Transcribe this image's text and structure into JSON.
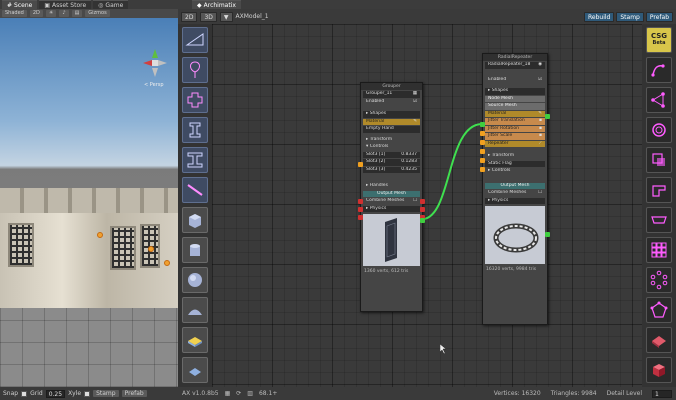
{
  "scene_tabs": [
    {
      "label": "Scene",
      "icon": "scene-icon"
    },
    {
      "label": "Asset Store",
      "icon": "store-icon"
    },
    {
      "label": "Game",
      "icon": "game-icon"
    }
  ],
  "ax_tab": {
    "label": "Archimatix"
  },
  "scene_toolbar": {
    "shading": "Shaded",
    "mode_2d": "2D",
    "gizmos": "Gizmos"
  },
  "scene_view": {
    "persp_label": "< Persp"
  },
  "scene_bottom": {
    "snap_label": "Snap",
    "grid_label": "Grid",
    "grid_value": "0.25",
    "xyle_label": "Xyle",
    "stamp": "Stamp",
    "prefab": "Prefab"
  },
  "ax_header": {
    "btn_2d": "2D",
    "btn_3d": "3D",
    "model_name": "AXModel_1",
    "rebuild": "Rebuild",
    "stamp": "Stamp",
    "prefab": "Prefab"
  },
  "library_icons": [
    "plane-shape-icon",
    "lamp-shape-icon",
    "cross-shape-icon",
    "ibeam-shape-icon",
    "ibeam-wide-icon",
    "bar-shape-icon",
    "box-mesh-icon",
    "cylinder-mesh-icon",
    "sphere-mesh-icon",
    "curved-plane-icon",
    "platform-mesh-icon",
    "library-more-icon"
  ],
  "grouper_node": {
    "title": "Grouper",
    "name": "Grouper_11",
    "enabled": "Enabled",
    "shapes": "Shapes",
    "material": "Material",
    "empty_hand": "Empty Hand",
    "transform": "Transform",
    "controls": "Controls",
    "params": [
      {
        "label": "Slot3 [1]",
        "value": "0.8337"
      },
      {
        "label": "Slot3 [2]",
        "value": "0.1283"
      },
      {
        "label": "Slot3 [3]",
        "value": "0.4235"
      }
    ],
    "handles": "Handles",
    "output_mesh": "Output Mesh",
    "combine_meshes": "Combine Meshes",
    "physics": "Physics",
    "stats": "1360 verts, 612 tris"
  },
  "radial_node": {
    "title": "RadialRepeater",
    "name": "RadialRepeater_18",
    "enabled": "Enabled",
    "shapes": "Shapes",
    "node_mesh": "Node Mesh",
    "source_mesh": "Source Mesh",
    "material": "Material",
    "jitter_translation": "Jitter Translation",
    "jitter_rotation": "Jitter Rotation",
    "jitter_scale": "Jitter Scale",
    "repeater": "Repeater",
    "transform": "Transform",
    "static_flag": "Static Flag",
    "controls": "Controls",
    "output_mesh": "Output Mesh",
    "combine_meshes": "Combine Meshes",
    "physics": "Physics",
    "stats": "16320 verts, 9984 tris"
  },
  "tools": {
    "csg_title": "CSG",
    "csg_sub": "Beta",
    "icons": [
      "spline-tool-icon",
      "graph-tool-icon",
      "circle-offset-icon",
      "shape-merge-icon",
      "step-shape-icon",
      "tab-shape-icon",
      "grid-repeater-icon",
      "radial-repeater-icon",
      "polygon-icon",
      "floor-plan-icon",
      "cube-icon"
    ]
  },
  "status": {
    "version": "AX v1.0.8b5",
    "zoom": "68.1+",
    "vertices": "Vertices: 16320",
    "triangles": "Triangles: 9984",
    "detail_label": "Detail Level",
    "detail_value": "1"
  }
}
